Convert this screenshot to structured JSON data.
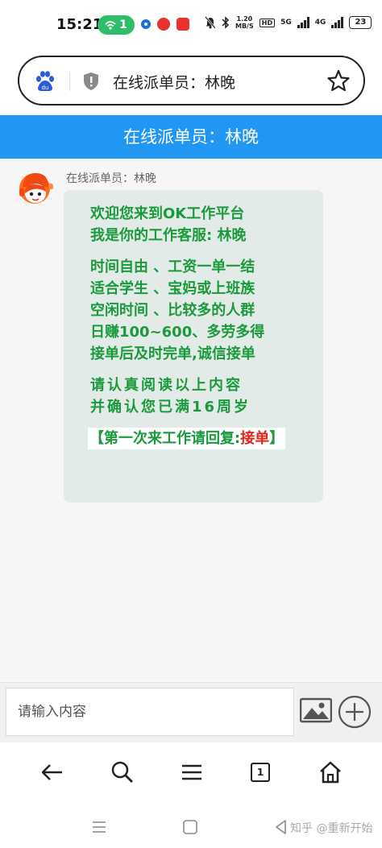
{
  "status_bar": {
    "time": "15:21",
    "hotspot_count": "1",
    "net_speed_value": "1.20",
    "net_speed_unit": "MB/S",
    "hd_label": "HD",
    "signal_1_label": "5G",
    "signal_2_label": "4G",
    "battery": "23"
  },
  "address_bar": {
    "title": "在线派单员：林晚"
  },
  "header": {
    "title": "在线派单员：林晚"
  },
  "chat": {
    "sender_name": "在线派单员：林晚",
    "message": {
      "greeting_1": "欢迎您来到OK工作平台",
      "greeting_2": "我是你的工作客服: 林晚",
      "line_1": "时间自由 、工资一单一结",
      "line_2": "适合学生 、宝妈或上班族",
      "line_3": "空闲时间 、比较多的人群",
      "line_4": "日赚100~600、多劳多得",
      "line_5": "接单后及时完单,诚信接单",
      "notice_1": "请认真阅读以上内容",
      "notice_2": "并确认您已满16周岁",
      "reply_prefix": "【第一次来工作请回复:",
      "reply_keyword": "接单",
      "reply_suffix": "】"
    }
  },
  "input": {
    "placeholder": "请输入内容"
  },
  "browser_nav": {
    "tab_count": "1"
  },
  "watermark": "知乎 @重新开始",
  "colors": {
    "header_blue": "#2196f3",
    "message_green": "#1a9a3c",
    "keyword_red": "#e0251b",
    "bubble_bg": "#e3ebe9",
    "hotspot_green": "#2ebd68"
  },
  "icons": [
    "baidu-paw-icon",
    "shield-icon",
    "star-icon",
    "image-icon",
    "plus-circle-icon",
    "back-arrow-icon",
    "search-icon",
    "menu-icon",
    "home-icon",
    "system-menu-icon",
    "system-home-icon",
    "system-back-icon"
  ]
}
